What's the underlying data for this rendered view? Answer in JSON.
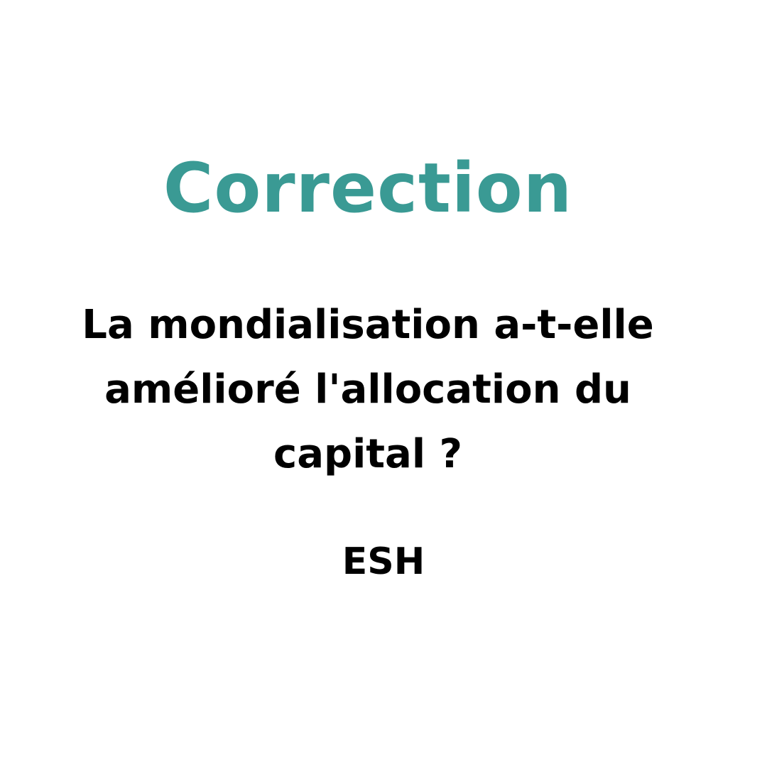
{
  "slide": {
    "title": "Correction",
    "question_lines": [
      "La mondialisation a-t-elle",
      "amélioré l'allocation du",
      "capital ?"
    ],
    "subject": "ESH"
  },
  "colors": {
    "background": "#ffffff",
    "title": "#3a9a94",
    "text": "#000000"
  }
}
